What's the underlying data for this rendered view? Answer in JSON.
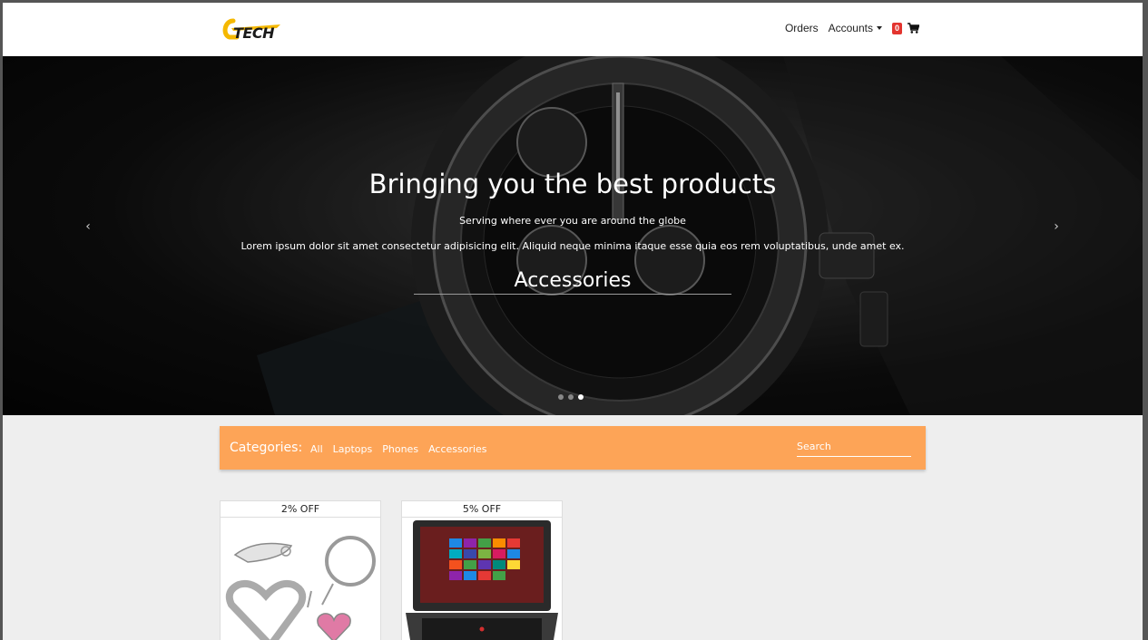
{
  "brand": {
    "logo_text": "TECH",
    "logo_color": "#f5b800"
  },
  "nav": {
    "orders_label": "Orders",
    "accounts_label": "Accounts",
    "cart_count": "0",
    "cart_icon": "shopping-cart-icon"
  },
  "hero": {
    "title": "Bringing you the best products",
    "subtitle": "Serving where ever you are around the globe",
    "description": "Lorem ipsum dolor sit amet consectetur adipisicing elit. Aliquid neque minima itaque esse quia eos rem voluptatibus, unde amet ex.",
    "category": "Accessories",
    "prev_icon": "‹",
    "next_icon": "›",
    "slides": 3,
    "active_slide": 3
  },
  "categories": {
    "label": "Categories:",
    "items": [
      "All",
      "Laptops",
      "Phones",
      "Accessories"
    ],
    "search_placeholder": "Search",
    "bar_color": "#fda457"
  },
  "products": [
    {
      "badge": "2% OFF",
      "image": "keychain-image"
    },
    {
      "badge": "5% OFF",
      "image": "laptop-image"
    }
  ]
}
